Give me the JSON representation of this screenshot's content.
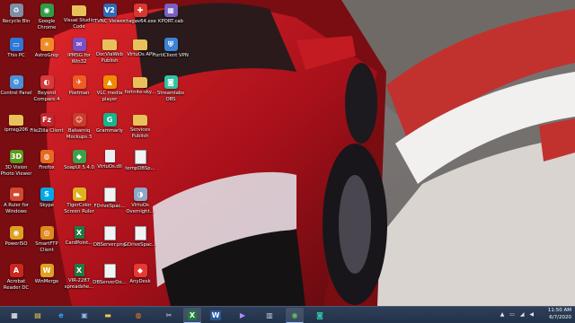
{
  "desktop": {
    "icons": [
      {
        "label": "Recycle Bin",
        "glyph": "recycle-bin-icon",
        "sym": "♻",
        "color": "#7d8fa6",
        "kind": "app"
      },
      {
        "label": "This PC",
        "glyph": "computer-icon",
        "sym": "▭",
        "color": "#2d78d6",
        "kind": "app"
      },
      {
        "label": "Control Panel",
        "glyph": "control-panel-icon",
        "sym": "⚙",
        "color": "#4a90d9",
        "kind": "app"
      },
      {
        "label": "ipmsg206",
        "glyph": "folder-icon",
        "sym": "",
        "color": "#e8c15a",
        "kind": "folder"
      },
      {
        "label": "3D Vision Photo Viewer",
        "glyph": "nvidia-3d-icon",
        "sym": "3D",
        "color": "#5c9a1e",
        "kind": "app"
      },
      {
        "label": "A Ruler for Windows",
        "glyph": "ruler-icon",
        "sym": "▬",
        "color": "#d14a2e",
        "kind": "app"
      },
      {
        "label": "PowerISO",
        "glyph": "disc-icon",
        "sym": "◉",
        "color": "#e0a020",
        "kind": "app"
      },
      {
        "label": "Acrobat Reader DC",
        "glyph": "acrobat-icon",
        "sym": "A",
        "color": "#c8281e",
        "kind": "app"
      },
      {
        "label": "Google Chrome",
        "glyph": "chrome-icon",
        "sym": "◉",
        "color": "#2f9e44",
        "kind": "app"
      },
      {
        "label": "AstroGrep",
        "glyph": "astrogrep-icon",
        "sym": "☀",
        "color": "#f08a24",
        "kind": "app"
      },
      {
        "label": "Beyond Compare 4",
        "glyph": "beyond-compare-icon",
        "sym": "◐",
        "color": "#d63a3a",
        "kind": "app"
      },
      {
        "label": "FileZilla Client",
        "glyph": "filezilla-icon",
        "sym": "Fz",
        "color": "#c0272d",
        "kind": "app"
      },
      {
        "label": "Firefox",
        "glyph": "firefox-icon",
        "sym": "◍",
        "color": "#e66a1f",
        "kind": "app"
      },
      {
        "label": "Skype",
        "glyph": "skype-icon",
        "sym": "S",
        "color": "#00a8e8",
        "kind": "app"
      },
      {
        "label": "SmartFTP Client",
        "glyph": "smartftp-icon",
        "sym": "◎",
        "color": "#e08a1e",
        "kind": "app"
      },
      {
        "label": "WinMerge",
        "glyph": "winmerge-icon",
        "sym": "W",
        "color": "#e0a020",
        "kind": "app"
      },
      {
        "label": "Visual Studio Code",
        "glyph": "folder-icon",
        "sym": "",
        "color": "#e8c15a",
        "kind": "folder"
      },
      {
        "label": "IPMSG for Win32",
        "glyph": "ipmsg-icon",
        "sym": "✉",
        "color": "#7a4fc7",
        "kind": "app"
      },
      {
        "label": "Postman",
        "glyph": "postman-icon",
        "sym": "✈",
        "color": "#ef5b25",
        "kind": "app"
      },
      {
        "label": "Balsamiq Mockups 3",
        "glyph": "balsamiq-icon",
        "sym": "☺",
        "color": "#cc3a2a",
        "kind": "app"
      },
      {
        "label": "SoapUI 5.4.0",
        "glyph": "soapui-icon",
        "sym": "◆",
        "color": "#3aa34a",
        "kind": "app"
      },
      {
        "label": "TigerColor Screen Ruler",
        "glyph": "screen-ruler-icon",
        "sym": "◣",
        "color": "#e0b020",
        "kind": "app"
      },
      {
        "label": "CardPoint...",
        "glyph": "excel-file-icon",
        "sym": "X",
        "color": "#1f7a43",
        "kind": "doc"
      },
      {
        "label": "VIR-2287 spreadshe...",
        "glyph": "excel-file-icon",
        "sym": "X",
        "color": "#1f7a43",
        "kind": "doc"
      },
      {
        "label": "TVNC Viewer",
        "glyph": "vnc-icon",
        "sym": "V2",
        "color": "#2e6bb8",
        "kind": "app"
      },
      {
        "label": "DocViaWeb Publish",
        "glyph": "folder-icon",
        "sym": "",
        "color": "#e8c15a",
        "kind": "folder"
      },
      {
        "label": "VLC media player",
        "glyph": "vlc-icon",
        "sym": "▲",
        "color": "#f08a00",
        "kind": "app"
      },
      {
        "label": "Grammarly",
        "glyph": "grammarly-icon",
        "sym": "G",
        "color": "#15b58d",
        "kind": "app"
      },
      {
        "label": "VirtuOs.dll",
        "glyph": "file-icon",
        "sym": "",
        "color": "#e9eef5",
        "kind": "doc"
      },
      {
        "label": "FDriveSpac...",
        "glyph": "text-file-icon",
        "sym": "",
        "color": "#f2f2f2",
        "kind": "doc"
      },
      {
        "label": "DBServer.png",
        "glyph": "image-file-icon",
        "sym": "",
        "color": "#f2f2f2",
        "kind": "doc"
      },
      {
        "label": "DBServerDe...",
        "glyph": "text-file-icon",
        "sym": "",
        "color": "#f2f2f2",
        "kind": "doc"
      },
      {
        "label": "ctagav64.exe",
        "glyph": "ctag-exe-icon",
        "sym": "✚",
        "color": "#d8382e",
        "kind": "app"
      },
      {
        "label": "VirtuOs API",
        "glyph": "folder-icon",
        "sym": "",
        "color": "#e8c15a",
        "kind": "folder"
      },
      {
        "label": "fortnite-sky...",
        "glyph": "folder-icon",
        "sym": "",
        "color": "#e8c15a",
        "kind": "folder"
      },
      {
        "label": "Services Publish",
        "glyph": "folder-icon",
        "sym": "",
        "color": "#e8c15a",
        "kind": "folder"
      },
      {
        "label": "tempDBSp...",
        "glyph": "text-file-icon",
        "sym": "",
        "color": "#f2f2f2",
        "kind": "doc"
      },
      {
        "label": "VirtuOs Overnight...",
        "glyph": "virtuos-icon",
        "sym": "◑",
        "color": "#8da7c7",
        "kind": "app"
      },
      {
        "label": "GDriveSpac...",
        "glyph": "text-file-icon",
        "sym": "",
        "color": "#f2f2f2",
        "kind": "doc"
      },
      {
        "label": "AnyDesk",
        "glyph": "anydesk-icon",
        "sym": "◆",
        "color": "#e53935",
        "kind": "app"
      },
      {
        "label": "KPORT.cab",
        "glyph": "cab-file-icon",
        "sym": "▦",
        "color": "#7a5fc2",
        "kind": "app"
      },
      {
        "label": "FortiClient VPN",
        "glyph": "forticlient-icon",
        "sym": "⛨",
        "color": "#3a83d6",
        "kind": "app"
      },
      {
        "label": "Streamlabs OBS",
        "glyph": "streamlabs-icon",
        "sym": "◙",
        "color": "#31c3a2",
        "kind": "app"
      }
    ]
  },
  "taskbar": {
    "items": [
      {
        "name": "start-button",
        "sym": "▦",
        "color": "#ffffff",
        "bg": "transparent",
        "active": false
      },
      {
        "name": "file-explorer-icon",
        "sym": "▤",
        "color": "#f2c94c",
        "bg": "transparent",
        "active": false
      },
      {
        "name": "internet-explorer-icon",
        "sym": "e",
        "color": "#3ba0ff",
        "bg": "transparent",
        "active": false
      },
      {
        "name": "remote-desktop-icon",
        "sym": "▣",
        "color": "#8fb8e8",
        "bg": "transparent",
        "active": false
      },
      {
        "name": "folder-icon",
        "sym": "▬",
        "color": "#f2c94c",
        "bg": "transparent",
        "active": false
      },
      {
        "name": "firefox-icon",
        "sym": "◍",
        "color": "#ff7a1a",
        "bg": "transparent",
        "active": false
      },
      {
        "name": "snipping-tool-icon",
        "sym": "✂",
        "color": "#d0d8e4",
        "bg": "transparent",
        "active": false
      },
      {
        "name": "excel-icon",
        "sym": "X",
        "color": "#ffffff",
        "bg": "#1f7a43",
        "active": true
      },
      {
        "name": "word-icon",
        "sym": "W",
        "color": "#ffffff",
        "bg": "#2b579a",
        "active": false
      },
      {
        "name": "visual-studio-icon",
        "sym": "▶",
        "color": "#b48cff",
        "bg": "transparent",
        "active": false
      },
      {
        "name": "ssms-icon",
        "sym": "▥",
        "color": "#c8d2e0",
        "bg": "transparent",
        "active": false
      },
      {
        "name": "chrome-icon",
        "sym": "◉",
        "color": "#5ac85a",
        "bg": "transparent",
        "active": true
      },
      {
        "name": "streamlabs-icon",
        "sym": "◙",
        "color": "#31c3a2",
        "bg": "transparent",
        "active": false
      }
    ],
    "time": "11:50 AM",
    "date": "6/7/2020",
    "tray_symbols": "▲ ▭ ◢ ◀"
  }
}
